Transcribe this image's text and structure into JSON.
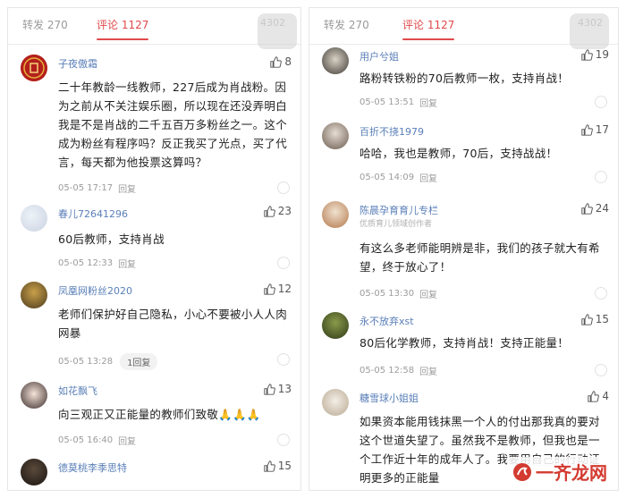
{
  "left": {
    "tabs": {
      "forward": "转发 270",
      "comments": "评论 1127",
      "likes": "4302"
    },
    "comments": [
      {
        "user": "子夜傲霜",
        "likes": "8",
        "text": "二十年教龄一线教师，227后成为肖战粉。因为之前从不关注娱乐圈，所以现在还没弄明白我是不是肖战的二千五百万多粉丝之一。这个成为粉丝有程序吗？反正我买了光点，买了代言，每天都为他投票这算吗？",
        "time": "05-05 17:17",
        "reply": "回复"
      },
      {
        "user": "春儿72641296",
        "likes": "23",
        "text": "60后教师，支持肖战",
        "time": "05-05 12:33",
        "reply": "回复"
      },
      {
        "user": "凤凰网粉丝2020",
        "likes": "12",
        "text": "老师们保护好自己隐私，小心不要被小人人肉网暴",
        "time": "05-05 13:28",
        "reply": "回复",
        "reply_count": "1回复"
      },
      {
        "user": "如花飘飞",
        "likes": "13",
        "text": "向三观正又正能量的教师们致敬",
        "emoji": "🙏🙏🙏",
        "time": "05-05 16:40",
        "reply": "回复"
      },
      {
        "user": "德莫桃李季思特",
        "likes": "15"
      }
    ]
  },
  "right": {
    "tabs": {
      "forward": "转发 270",
      "comments": "评论 1127",
      "likes": "4302"
    },
    "comments": [
      {
        "user": "用户兮姐",
        "likes": "19",
        "text": "路粉转铁粉的70后教师一枚，支持肖战！",
        "time": "05-05 13:51",
        "reply": "回复"
      },
      {
        "user": "百折不挠1979",
        "likes": "17",
        "text": "哈哈，我也是教师，70后，支持战战！",
        "time": "05-05 14:09",
        "reply": "回复"
      },
      {
        "user": "陈晨孕育育儿专栏",
        "subtitle": "优质育儿领域创作者",
        "likes": "24",
        "text": "有这么多老师能明辨是非，我们的孩子就大有希望，终于放心了！",
        "time": "05-05 13:30",
        "reply": "回复"
      },
      {
        "user": "永不放弃xst",
        "likes": "15",
        "text": "80后化学教师，支持肖战！支持正能量！",
        "time": "05-05 12:58",
        "reply": "回复"
      },
      {
        "user": "糖雪球小姐姐",
        "likes": "4",
        "text": "如果资本能用钱抹黑一个人的付出那我真的要对这个世道失望了。虽然我不是教师，但我也是一个工作近十年的成年人了。我要用自己的行动证明更多的正能量"
      }
    ]
  },
  "watermark": {
    "text": "一齐龙网"
  },
  "colors": {
    "accent": "#e0494c",
    "username": "#5a7fb8"
  },
  "icons": [
    "thumb-up-icon",
    "more-icon",
    "avatar-image"
  ]
}
